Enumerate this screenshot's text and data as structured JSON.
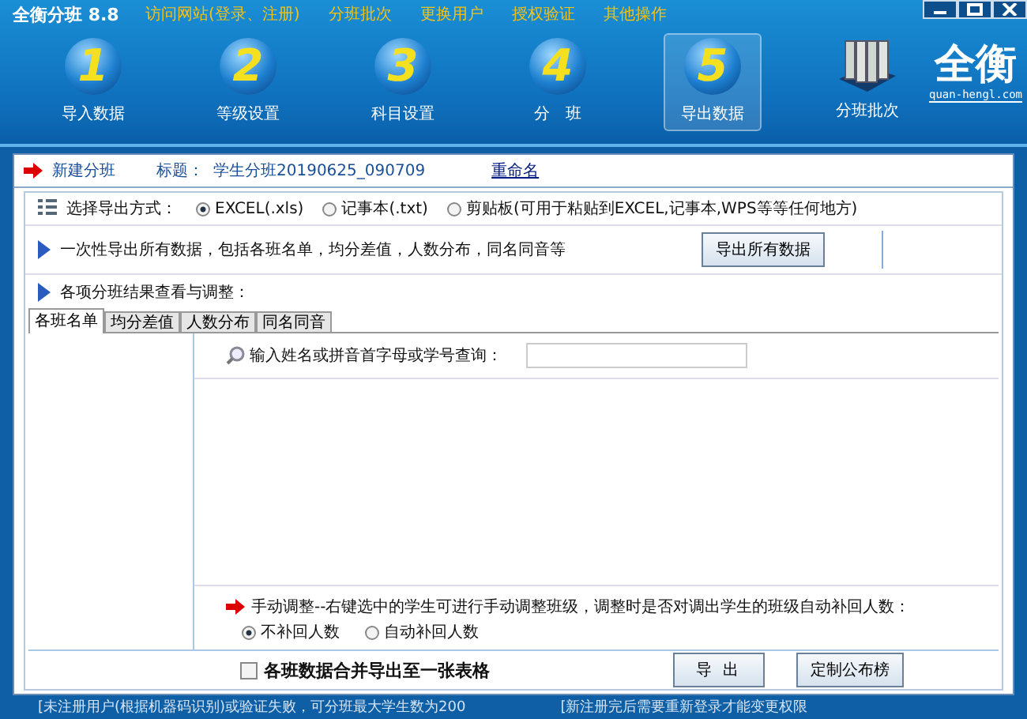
{
  "window": {
    "title": "全衡分班 8.8"
  },
  "menu": [
    "访问网站(登录、注册)",
    "分班批次",
    "更换用户",
    "授权验证",
    "其他操作"
  ],
  "steps": [
    {
      "number": "1",
      "label": "导入数据",
      "selected": false
    },
    {
      "number": "2",
      "label": "等级设置",
      "selected": false
    },
    {
      "number": "3",
      "label": "科目设置",
      "selected": false
    },
    {
      "number": "4",
      "label": "分　班",
      "selected": false
    },
    {
      "number": "5",
      "label": "导出数据",
      "selected": true
    }
  ],
  "batch_button": "分班批次",
  "logo": {
    "name": "全衡",
    "url": "quan-hengl.com"
  },
  "info_bar": {
    "heading": "新建分班",
    "title_label": "标题：",
    "title_value": "学生分班20190625_090709",
    "rename_link": "重命名"
  },
  "export_format": {
    "label": "选择导出方式：",
    "options": [
      {
        "label": "EXCEL(.xls)",
        "selected": true
      },
      {
        "label": "记事本(.txt)",
        "selected": false
      },
      {
        "label": "剪贴板(可用于粘贴到EXCEL,记事本,WPS等等任何地方)",
        "selected": false
      }
    ]
  },
  "export_all": {
    "text": "一次性导出所有数据，包括各班名单，均分差值，人数分布，同名同音等",
    "button": "导出所有数据"
  },
  "results_heading": "各项分班结果查看与调整：",
  "tabs": [
    {
      "label": "各班名单",
      "selected": true
    },
    {
      "label": "均分差值",
      "selected": false
    },
    {
      "label": "人数分布",
      "selected": false
    },
    {
      "label": "同名同音",
      "selected": false
    }
  ],
  "search": {
    "label": "输入姓名或拼音首字母或学号查询："
  },
  "manual_adjust": {
    "text": "手动调整--右键选中的学生可进行手动调整班级，调整时是否对调出学生的班级自动补回人数：",
    "options": [
      {
        "label": "不补回人数",
        "selected": true
      },
      {
        "label": "自动补回人数",
        "selected": false
      }
    ]
  },
  "merge_checkbox": {
    "label": "各班数据合并导出至一张表格",
    "checked": false
  },
  "buttons": [
    "导 出",
    "定制公布榜"
  ],
  "status_bar": [
    "[未注册用户(根据机器码识别)或验证失败，可分班最大学生数为200",
    "[新注册完后需要重新登录才能变更权限"
  ]
}
